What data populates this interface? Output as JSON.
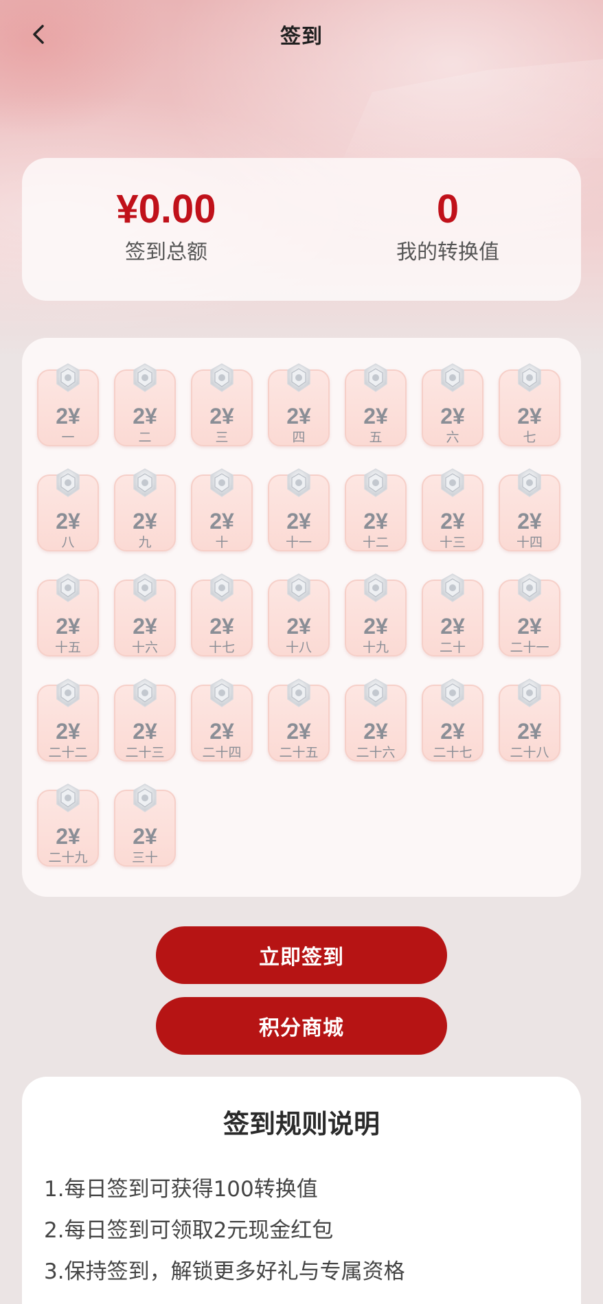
{
  "colors": {
    "brand_red": "#b61414",
    "value_red": "#c0111a",
    "tag_fill": "#fde6e2",
    "muted_text": "#8a8e96"
  },
  "nav": {
    "back_icon": "chevron-left-icon",
    "title": "签到"
  },
  "summary": {
    "total": {
      "value": "¥0.00",
      "label": "签到总额"
    },
    "conversion": {
      "value": "0",
      "label": "我的转换值"
    }
  },
  "calendar": {
    "medal_icon": "medal-icon",
    "days": [
      {
        "amount": "2¥",
        "label": "一"
      },
      {
        "amount": "2¥",
        "label": "二"
      },
      {
        "amount": "2¥",
        "label": "三"
      },
      {
        "amount": "2¥",
        "label": "四"
      },
      {
        "amount": "2¥",
        "label": "五"
      },
      {
        "amount": "2¥",
        "label": "六"
      },
      {
        "amount": "2¥",
        "label": "七"
      },
      {
        "amount": "2¥",
        "label": "八"
      },
      {
        "amount": "2¥",
        "label": "九"
      },
      {
        "amount": "2¥",
        "label": "十"
      },
      {
        "amount": "2¥",
        "label": "十一"
      },
      {
        "amount": "2¥",
        "label": "十二"
      },
      {
        "amount": "2¥",
        "label": "十三"
      },
      {
        "amount": "2¥",
        "label": "十四"
      },
      {
        "amount": "2¥",
        "label": "十五"
      },
      {
        "amount": "2¥",
        "label": "十六"
      },
      {
        "amount": "2¥",
        "label": "十七"
      },
      {
        "amount": "2¥",
        "label": "十八"
      },
      {
        "amount": "2¥",
        "label": "十九"
      },
      {
        "amount": "2¥",
        "label": "二十"
      },
      {
        "amount": "2¥",
        "label": "二十一"
      },
      {
        "amount": "2¥",
        "label": "二十二"
      },
      {
        "amount": "2¥",
        "label": "二十三"
      },
      {
        "amount": "2¥",
        "label": "二十四"
      },
      {
        "amount": "2¥",
        "label": "二十五"
      },
      {
        "amount": "2¥",
        "label": "二十六"
      },
      {
        "amount": "2¥",
        "label": "二十七"
      },
      {
        "amount": "2¥",
        "label": "二十八"
      },
      {
        "amount": "2¥",
        "label": "二十九"
      },
      {
        "amount": "2¥",
        "label": "三十"
      }
    ]
  },
  "actions": {
    "sign_in_label": "立即签到",
    "mall_label": "积分商城"
  },
  "rules": {
    "title": "签到规则说明",
    "items": [
      "1.每日签到可获得100转换值",
      "2.每日签到可领取2元现金红包",
      "3.保持签到，解锁更多好礼与专属资格"
    ]
  }
}
